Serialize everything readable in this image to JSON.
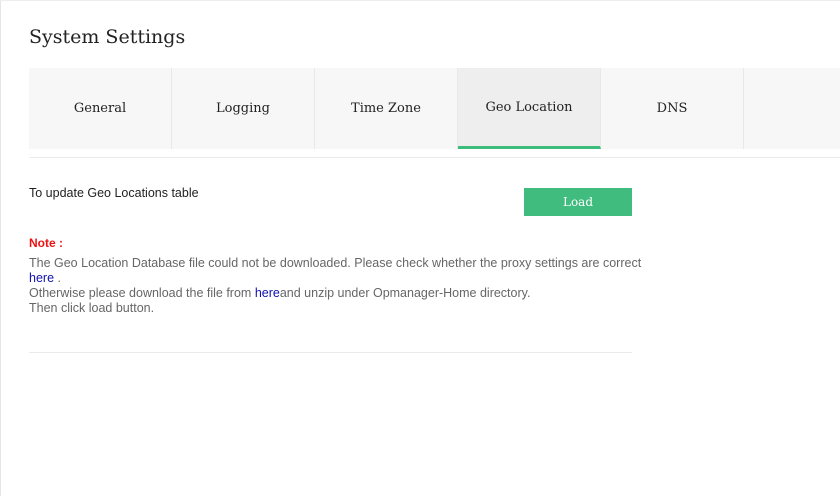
{
  "page": {
    "title": "System Settings"
  },
  "tabs": [
    {
      "label": "General"
    },
    {
      "label": "Logging"
    },
    {
      "label": "Time Zone"
    },
    {
      "label": "Geo Location",
      "active": true
    },
    {
      "label": "DNS"
    },
    {
      "label": ""
    }
  ],
  "geo": {
    "update_label": "To update Geo Locations table",
    "load_button": "Load",
    "note_label": "Note :",
    "line1": "The Geo Location Database file could not be downloaded. Please check whether the proxy settings are correct",
    "line2_link": "here",
    "line2_suffix": " .",
    "line3_prefix": "Otherwise please download the file from ",
    "line3_link": "here",
    "line3_suffix": "and unzip under Opmanager-Home directory.",
    "line4": "Then click load button."
  },
  "colors": {
    "accent": "#40bc7e",
    "note": "#ee1111",
    "link": "#1111aa",
    "muted_text": "#666666"
  }
}
